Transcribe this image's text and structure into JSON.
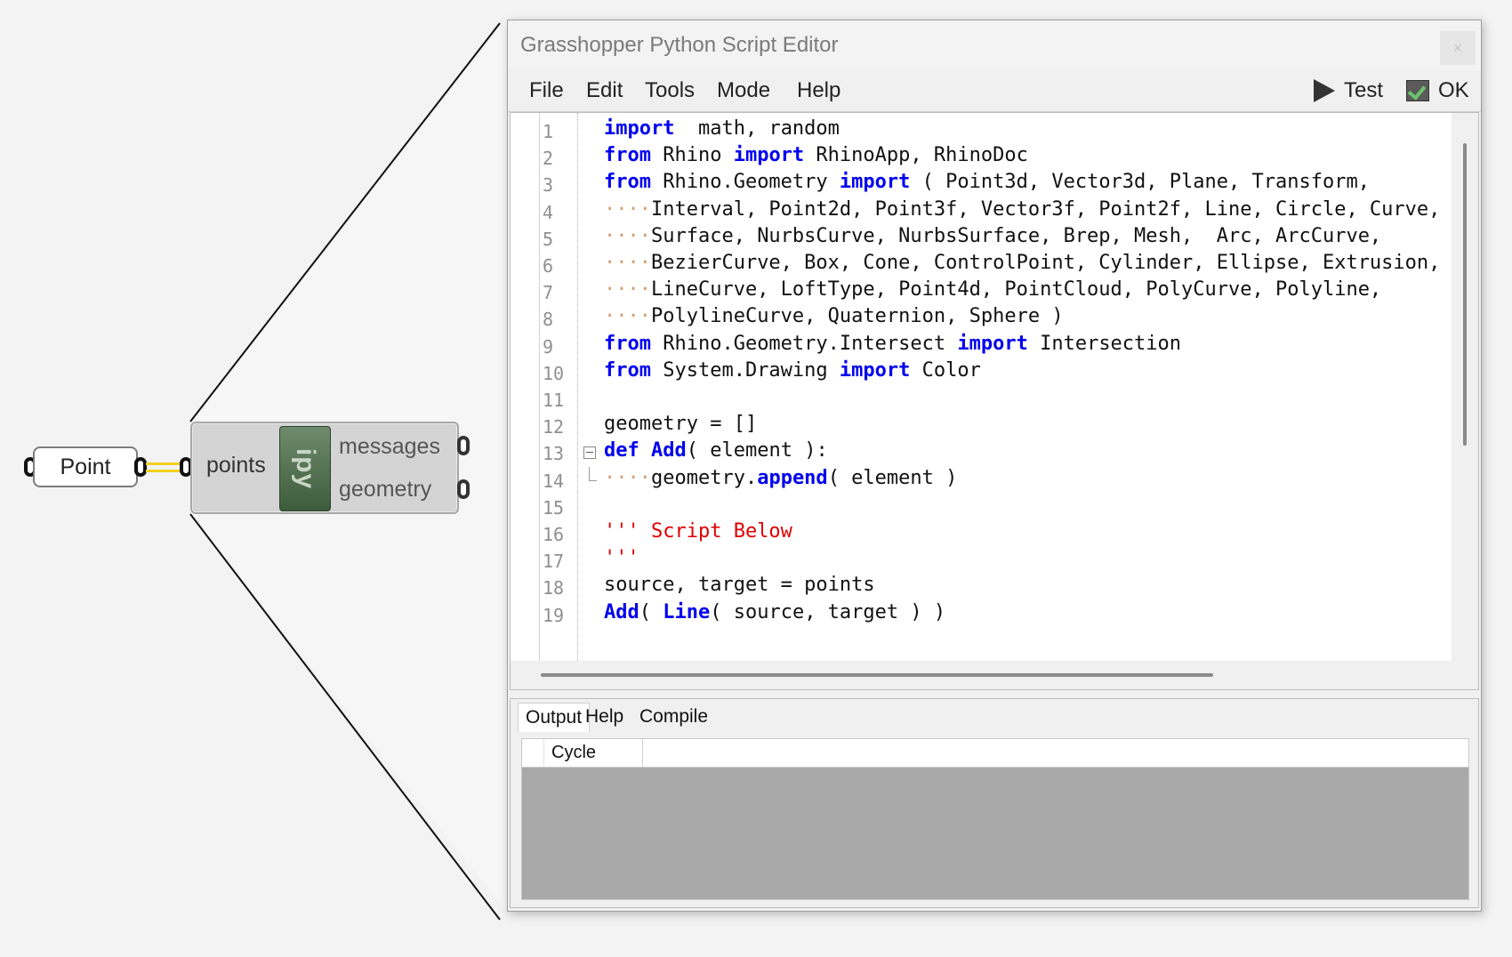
{
  "canvas": {
    "point_component": {
      "label": "Point"
    },
    "python_component": {
      "input": "points",
      "icon_text": "ipy",
      "outputs": [
        "messages",
        "geometry"
      ]
    }
  },
  "editor": {
    "title": "Grasshopper Python Script Editor",
    "close_label": "×",
    "menu": [
      "File",
      "Edit",
      "Tools",
      "Mode",
      "Help"
    ],
    "toolbar": {
      "test_label": "Test",
      "ok_label": "OK"
    },
    "code_lines": [
      {
        "n": "1",
        "segs": [
          [
            "kw",
            "import"
          ],
          [
            "",
            "  math, random"
          ]
        ]
      },
      {
        "n": "2",
        "segs": [
          [
            "kw",
            "from"
          ],
          [
            "",
            " Rhino "
          ],
          [
            "kw",
            "import"
          ],
          [
            "",
            " RhinoApp, RhinoDoc"
          ]
        ]
      },
      {
        "n": "3",
        "segs": [
          [
            "kw",
            "from"
          ],
          [
            "",
            " Rhino.Geometry "
          ],
          [
            "kw",
            "import"
          ],
          [
            "",
            " ( Point3d, Vector3d, Plane, Transform,"
          ]
        ]
      },
      {
        "n": "4",
        "segs": [
          [
            "ws",
            "····"
          ],
          [
            "",
            "Interval, Point2d, Point3f, Vector3f, Point2f, Line, Circle, Curve,"
          ]
        ]
      },
      {
        "n": "5",
        "segs": [
          [
            "ws",
            "····"
          ],
          [
            "",
            "Surface, NurbsCurve, NurbsSurface, Brep, Mesh,  Arc, ArcCurve,"
          ]
        ]
      },
      {
        "n": "6",
        "segs": [
          [
            "ws",
            "····"
          ],
          [
            "",
            "BezierCurve, Box, Cone, ControlPoint, Cylinder, Ellipse, Extrusion,"
          ]
        ]
      },
      {
        "n": "7",
        "segs": [
          [
            "ws",
            "····"
          ],
          [
            "",
            "LineCurve, LoftType, Point4d, PointCloud, PolyCurve, Polyline,"
          ]
        ]
      },
      {
        "n": "8",
        "segs": [
          [
            "ws",
            "····"
          ],
          [
            "",
            "PolylineCurve, Quaternion, Sphere )"
          ]
        ]
      },
      {
        "n": "9",
        "segs": [
          [
            "kw",
            "from"
          ],
          [
            "",
            " Rhino.Geometry.Intersect "
          ],
          [
            "kw",
            "import"
          ],
          [
            "",
            " Intersection"
          ]
        ]
      },
      {
        "n": "10",
        "segs": [
          [
            "kw",
            "from"
          ],
          [
            "",
            " System.Drawing "
          ],
          [
            "kw",
            "import"
          ],
          [
            "",
            " Color"
          ]
        ]
      },
      {
        "n": "11",
        "segs": []
      },
      {
        "n": "12",
        "segs": [
          [
            "",
            "geometry = []"
          ]
        ]
      },
      {
        "n": "13",
        "segs": [
          [
            "kw",
            "def"
          ],
          [
            "",
            " "
          ],
          [
            "kw",
            "Add"
          ],
          [
            "",
            "( element ):"
          ]
        ]
      },
      {
        "n": "14",
        "segs": [
          [
            "ws",
            "····"
          ],
          [
            "",
            "geometry."
          ],
          [
            "kw",
            "append"
          ],
          [
            "",
            "( element )"
          ]
        ]
      },
      {
        "n": "15",
        "segs": []
      },
      {
        "n": "16",
        "segs": [
          [
            "str",
            "''' Script Below"
          ]
        ]
      },
      {
        "n": "17",
        "segs": [
          [
            "str",
            "'''"
          ]
        ]
      },
      {
        "n": "18",
        "segs": [
          [
            "",
            "source, target = points"
          ]
        ]
      },
      {
        "n": "19",
        "segs": [
          [
            "kw",
            "Add"
          ],
          [
            "",
            "( "
          ],
          [
            "kw",
            "Line"
          ],
          [
            "",
            "( source, target ) )"
          ]
        ]
      }
    ],
    "bottom_tabs": [
      "Output",
      "Help",
      "Compile"
    ],
    "output_table": {
      "columns": [
        "Cycle"
      ]
    }
  },
  "colors": {
    "keyword": "#0000ee",
    "string": "#e00000",
    "whitespace": "#d4a070",
    "wire": "#f0d020"
  }
}
